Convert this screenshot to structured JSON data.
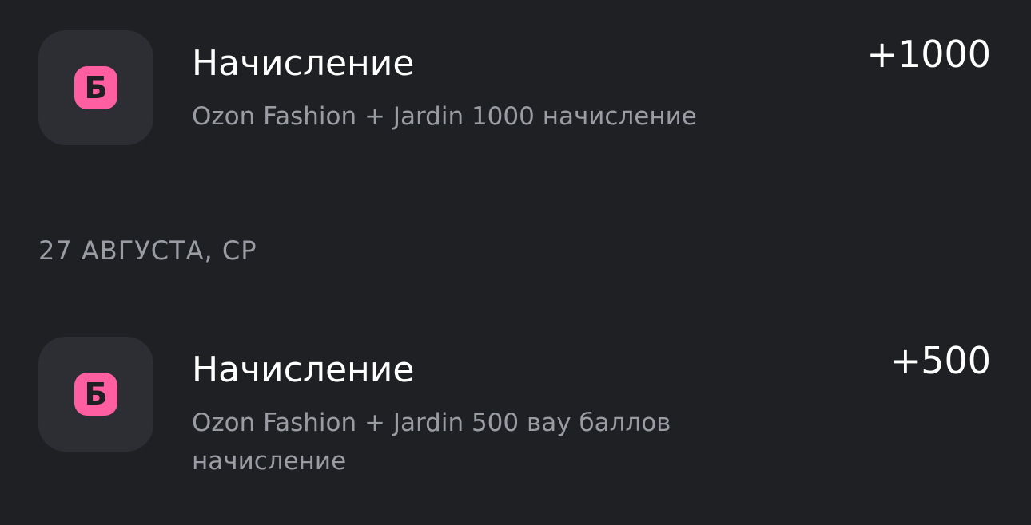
{
  "transactions": [
    {
      "icon": "b-letter-icon",
      "icon_glyph": "Б",
      "title": "Начисление",
      "subtitle": "Ozon Fashion + Jardin 1000 начисление",
      "amount": "+1000"
    },
    {
      "icon": "b-letter-icon",
      "icon_glyph": "Б",
      "title": "Начисление",
      "subtitle": "Ozon Fashion + Jardin 500 вау баллов начисление",
      "amount": "+500"
    }
  ],
  "date_header": "27 АВГУСТА, СР",
  "colors": {
    "background": "#1e2024",
    "tile": "#2d2e33",
    "badge": "#ff5fa1",
    "primary_text": "#ffffff",
    "secondary_text": "#9a9ca3"
  }
}
